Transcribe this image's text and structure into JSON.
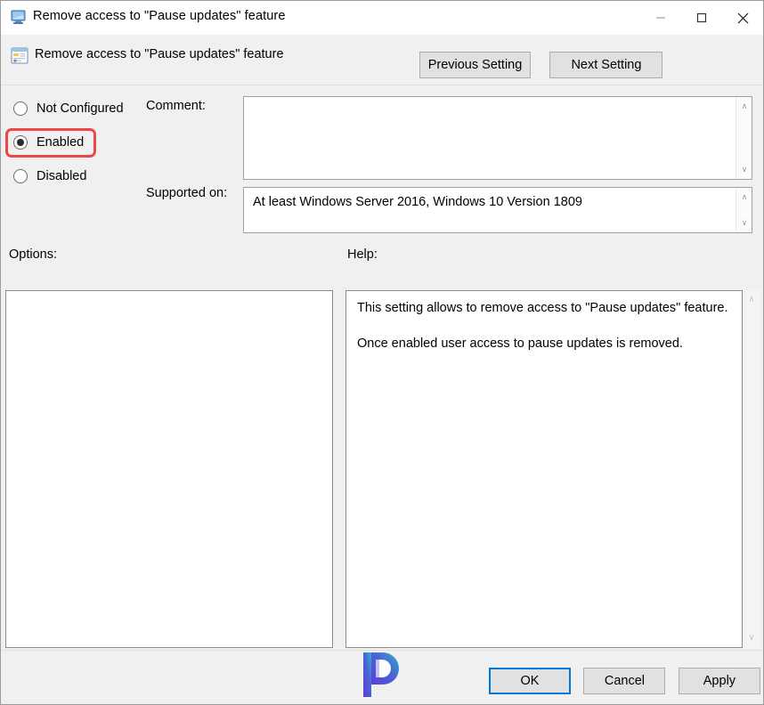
{
  "window": {
    "title": "Remove access to \"Pause updates\" feature",
    "icon": "computer-monitor-icon",
    "caption": {
      "minimize": "—",
      "maximize": "☐",
      "close": "✕"
    }
  },
  "header": {
    "title": "Remove access to \"Pause updates\" feature",
    "icon": "policy-setting-icon",
    "previous_label": "Previous Setting",
    "next_label": "Next Setting"
  },
  "state": {
    "selected": "Enabled",
    "highlight_color": "#ec4646",
    "options": [
      {
        "label": "Not Configured",
        "checked": false
      },
      {
        "label": "Enabled",
        "checked": true
      },
      {
        "label": "Disabled",
        "checked": false
      }
    ]
  },
  "comment": {
    "label": "Comment:",
    "value": "",
    "scroll_up": "∧",
    "scroll_down": "∨"
  },
  "supported": {
    "label": "Supported on:",
    "value": "At least Windows Server 2016, Windows 10 Version 1809",
    "scroll_up": "∧",
    "scroll_down": "∨"
  },
  "options_panel": {
    "label": "Options:",
    "content": ""
  },
  "help_panel": {
    "label": "Help:",
    "paragraph1": "This setting allows to remove access to \"Pause updates\" feature.",
    "paragraph2": "Once enabled user access to pause updates is removed.",
    "scroll_up": "∧",
    "scroll_down": "∨"
  },
  "footer": {
    "ok_label": "OK",
    "cancel_label": "Cancel",
    "apply_label": "Apply",
    "focus_color": "#0078d7",
    "watermark": "P"
  }
}
